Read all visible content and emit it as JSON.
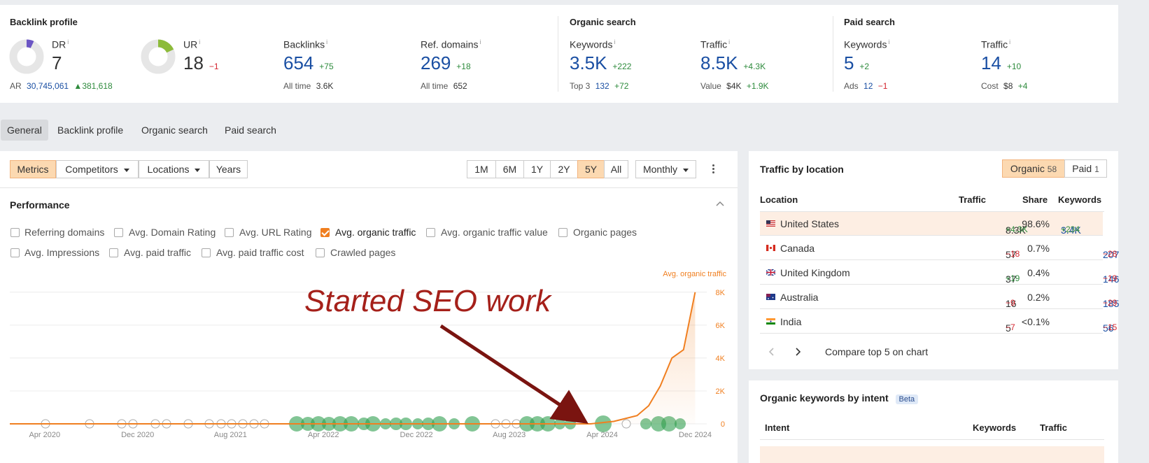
{
  "backlink_profile": {
    "title": "Backlink profile",
    "dr": {
      "label": "DR",
      "value": "7",
      "fraction": 0.07
    },
    "ar": {
      "label": "AR",
      "value": "30,745,061",
      "change": "381,618"
    },
    "ur": {
      "label": "UR",
      "value": "18",
      "change": "−1",
      "fraction": 0.18
    },
    "backlinks": {
      "label": "Backlinks",
      "value": "654",
      "change": "+75",
      "alltime_label": "All time",
      "alltime": "3.6K"
    },
    "ref_domains": {
      "label": "Ref. domains",
      "value": "269",
      "change": "+18",
      "alltime_label": "All time",
      "alltime": "652"
    }
  },
  "organic_search": {
    "title": "Organic search",
    "keywords": {
      "label": "Keywords",
      "value": "3.5K",
      "change": "+222",
      "sub_label": "Top 3",
      "sub_value": "132",
      "sub_change": "+72"
    },
    "traffic": {
      "label": "Traffic",
      "value": "8.5K",
      "change": "+4.3K",
      "sub_label": "Value",
      "sub_value": "$4K",
      "sub_change": "+1.9K"
    }
  },
  "paid_search": {
    "title": "Paid search",
    "keywords": {
      "label": "Keywords",
      "value": "5",
      "change": "+2",
      "sub_label": "Ads",
      "sub_value": "12",
      "sub_change": "−1"
    },
    "traffic": {
      "label": "Traffic",
      "value": "14",
      "change": "+10",
      "sub_label": "Cost",
      "sub_value": "$8",
      "sub_change": "+4"
    }
  },
  "tabs": [
    {
      "label": "General",
      "active": true
    },
    {
      "label": "Backlink profile"
    },
    {
      "label": "Organic search"
    },
    {
      "label": "Paid search"
    }
  ],
  "toolbar": {
    "metrics": "Metrics",
    "competitors": "Competitors",
    "locations": "Locations",
    "years": "Years",
    "ranges": [
      "1M",
      "6M",
      "1Y",
      "2Y",
      "5Y",
      "All"
    ],
    "active_range": "5Y",
    "interval": "Monthly"
  },
  "performance": {
    "title": "Performance",
    "checkboxes": [
      {
        "label": "Referring domains",
        "checked": false
      },
      {
        "label": "Avg. Domain Rating",
        "checked": false
      },
      {
        "label": "Avg. URL Rating",
        "checked": false
      },
      {
        "label": "Avg. organic traffic",
        "checked": true
      },
      {
        "label": "Avg. organic traffic value",
        "checked": false
      },
      {
        "label": "Organic pages",
        "checked": false
      },
      {
        "label": "Avg. Impressions",
        "checked": false
      },
      {
        "label": "Avg. paid traffic",
        "checked": false
      },
      {
        "label": "Avg. paid traffic cost",
        "checked": false
      },
      {
        "label": "Crawled pages",
        "checked": false
      }
    ],
    "annotation": "Started SEO work"
  },
  "chart_data": {
    "type": "area",
    "series_label": "Avg. organic traffic",
    "color": "#f07f20",
    "x_tick_labels": [
      "Apr 2020",
      "Dec 2020",
      "Aug 2021",
      "Apr 2022",
      "Dec 2022",
      "Aug 2023",
      "Apr 2024",
      "Dec 2024"
    ],
    "y_tick_labels": [
      "0",
      "2K",
      "4K",
      "6K",
      "8K"
    ],
    "ylim": [
      0,
      8500
    ],
    "x": [
      "2020-01",
      "2024-03",
      "2024-05",
      "2024-07",
      "2024-08",
      "2024-09",
      "2024-10",
      "2024-11",
      "2024-12"
    ],
    "values": [
      0,
      0,
      150,
      500,
      1100,
      2300,
      4000,
      4500,
      8000
    ],
    "grid": true
  },
  "traffic_by_location": {
    "title": "Traffic by location",
    "toggle": {
      "organic_label": "Organic",
      "organic_count": "58",
      "paid_label": "Paid",
      "paid_count": "1"
    },
    "headers": {
      "location": "Location",
      "traffic": "Traffic",
      "share": "Share",
      "keywords": "Keywords"
    },
    "rows": [
      {
        "country": "United States",
        "traffic": "8.3K",
        "traffic_change": "+4.3K",
        "share": "98.6%",
        "keywords": "3.4K",
        "keywords_change": "+234"
      },
      {
        "country": "Canada",
        "traffic": "57",
        "traffic_change": "−18",
        "share": "0.7%",
        "keywords": "207",
        "keywords_change": "−28"
      },
      {
        "country": "United Kingdom",
        "traffic": "37",
        "traffic_change": "+19",
        "share": "0.4%",
        "keywords": "146",
        "keywords_change": "−19"
      },
      {
        "country": "Australia",
        "traffic": "16",
        "traffic_change": "−9",
        "share": "0.2%",
        "keywords": "185",
        "keywords_change": "−29"
      },
      {
        "country": "India",
        "traffic": "5",
        "traffic_change": "−7",
        "share": "<0.1%",
        "keywords": "56",
        "keywords_change": "−15"
      }
    ],
    "compare_label": "Compare top 5 on chart"
  },
  "keywords_by_intent": {
    "title": "Organic keywords by intent",
    "badge": "Beta",
    "headers": {
      "intent": "Intent",
      "keywords": "Keywords",
      "traffic": "Traffic"
    }
  }
}
